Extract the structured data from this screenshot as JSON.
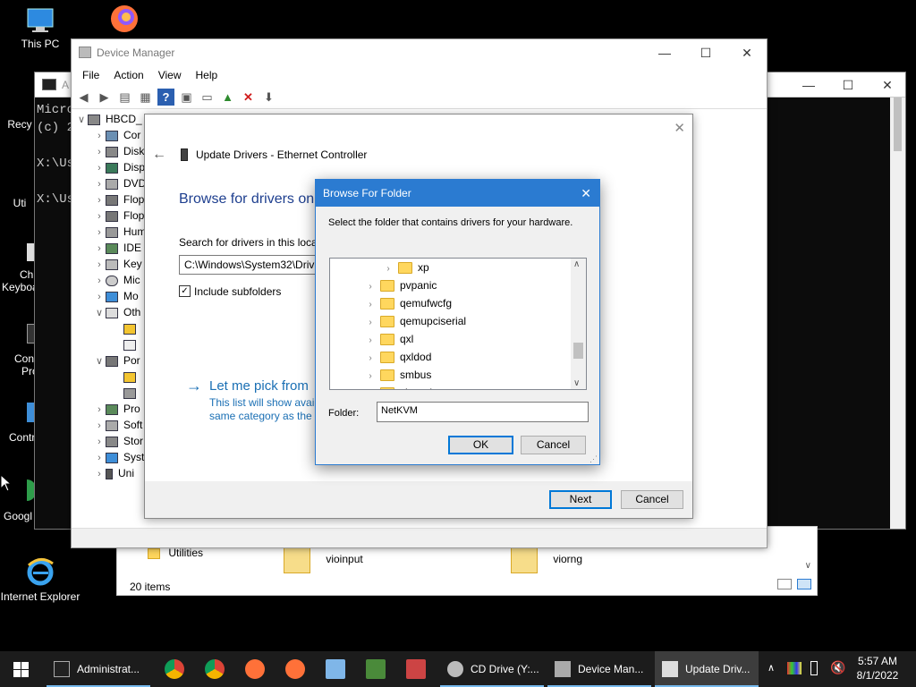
{
  "desktop": {
    "icons": [
      {
        "label": "This PC"
      },
      {
        "label": ""
      },
      {
        "label": "Recy"
      },
      {
        "label": "Uti"
      },
      {
        "label": "Ch"
      },
      {
        "label": "Keyboa"
      },
      {
        "label": "Con"
      },
      {
        "label": "Pro"
      },
      {
        "label": "Contr"
      },
      {
        "label": "Googl"
      },
      {
        "label": "Internet Explorer"
      }
    ]
  },
  "cmd": {
    "title": "A",
    "lines": [
      "Micro",
      "(c) 2",
      "",
      "X:\\Us",
      "",
      "X:\\Us"
    ]
  },
  "explorer": {
    "items": [
      {
        "label": "Utilities"
      },
      {
        "label": "vioinput"
      },
      {
        "label": "viorng"
      }
    ],
    "status": "20 items"
  },
  "device_manager": {
    "title": "Device Manager",
    "menu": [
      "File",
      "Action",
      "View",
      "Help"
    ],
    "tree": [
      {
        "label": "HBCD_",
        "chev": "∨"
      },
      {
        "label": "Cor",
        "chev": "›"
      },
      {
        "label": "Disk",
        "chev": "›"
      },
      {
        "label": "Disp",
        "chev": "›"
      },
      {
        "label": "DVD",
        "chev": "›"
      },
      {
        "label": "Flop",
        "chev": "›"
      },
      {
        "label": "Flop",
        "chev": "›"
      },
      {
        "label": "Hum",
        "chev": "›"
      },
      {
        "label": "IDE",
        "chev": "›"
      },
      {
        "label": "Key",
        "chev": "›"
      },
      {
        "label": "Mic",
        "chev": "›"
      },
      {
        "label": "Mo",
        "chev": "›"
      },
      {
        "label": "Oth",
        "chev": "∨"
      },
      {
        "label": "",
        "chev": ""
      },
      {
        "label": "",
        "chev": ""
      },
      {
        "label": "Por",
        "chev": "∨"
      },
      {
        "label": "",
        "chev": ""
      },
      {
        "label": "",
        "chev": ""
      },
      {
        "label": "Pro",
        "chev": "›"
      },
      {
        "label": "Soft",
        "chev": "›"
      },
      {
        "label": "Stor",
        "chev": "›"
      },
      {
        "label": "Syst",
        "chev": "›"
      },
      {
        "label": "Uni",
        "chev": "›"
      }
    ]
  },
  "wizard": {
    "header": "Update Drivers - Ethernet Controller",
    "heading": "Browse for drivers on",
    "search_label": "Search for drivers in this loca",
    "path_value": "C:\\Windows\\System32\\Driv",
    "include_subfolders": "Include subfolders",
    "pick_link": "Let me pick from",
    "pick_desc_1": "This list will show avail",
    "pick_desc_2": "same category as the d",
    "next": "Next",
    "cancel": "Cancel"
  },
  "browse": {
    "title": "Browse For Folder",
    "instruction": "Select the folder that contains drivers for your hardware.",
    "folders": [
      "xp",
      "pvpanic",
      "qemufwcfg",
      "qemupciserial",
      "qxl",
      "qxldod",
      "smbus",
      "vioscsi"
    ],
    "folder_label": "Folder:",
    "folder_value": "NetKVM",
    "ok": "OK",
    "cancel": "Cancel"
  },
  "taskbar": {
    "buttons": [
      {
        "label": "Administrat..."
      },
      {
        "label": "CD Drive (Y:..."
      },
      {
        "label": "Device Man..."
      },
      {
        "label": "Update Driv..."
      }
    ],
    "time": "5:57 AM",
    "date": "8/1/2022"
  },
  "colors": {
    "accent": "#0078d7",
    "dialog_title": "#2b7bd1",
    "taskbar": "#1c1c1c",
    "link": "#1a6fb4"
  }
}
